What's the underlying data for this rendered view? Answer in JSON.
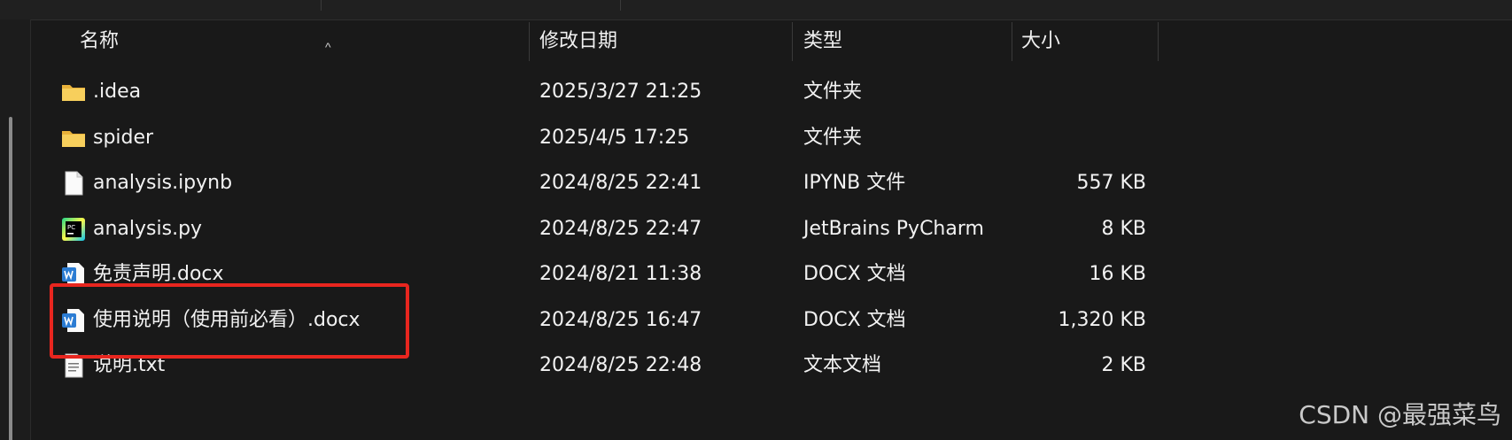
{
  "header": {
    "name": "名称",
    "date": "修改日期",
    "type": "类型",
    "size": "大小",
    "sort_indicator": "^"
  },
  "files": [
    {
      "icon": "folder-icon",
      "name": ".idea",
      "date": "2025/3/27 21:25",
      "type": "文件夹",
      "size": ""
    },
    {
      "icon": "folder-icon",
      "name": "spider",
      "date": "2025/4/5 17:25",
      "type": "文件夹",
      "size": ""
    },
    {
      "icon": "document-icon",
      "name": "analysis.ipynb",
      "date": "2024/8/25 22:41",
      "type": "IPYNB 文件",
      "size": "557 KB"
    },
    {
      "icon": "pycharm-icon",
      "name": "analysis.py",
      "date": "2024/8/25 22:47",
      "type": "JetBrains PyCharm",
      "size": "8 KB"
    },
    {
      "icon": "word-doc-icon",
      "name": "免责声明.docx",
      "date": "2024/8/21 11:38",
      "type": "DOCX 文档",
      "size": "16 KB"
    },
    {
      "icon": "word-doc-icon",
      "name": "使用说明（使用前必看）.docx",
      "date": "2024/8/25 16:47",
      "type": "DOCX 文档",
      "size": "1,320 KB"
    },
    {
      "icon": "text-file-icon",
      "name": "说明.txt",
      "date": "2024/8/25 22:48",
      "type": "文本文档",
      "size": "2 KB"
    }
  ],
  "watermark": "CSDN @最强菜鸟",
  "colors": {
    "background": "#191919",
    "folder": "#f2c14e",
    "highlight": "#e8261f",
    "word": "#2b7cd3"
  }
}
